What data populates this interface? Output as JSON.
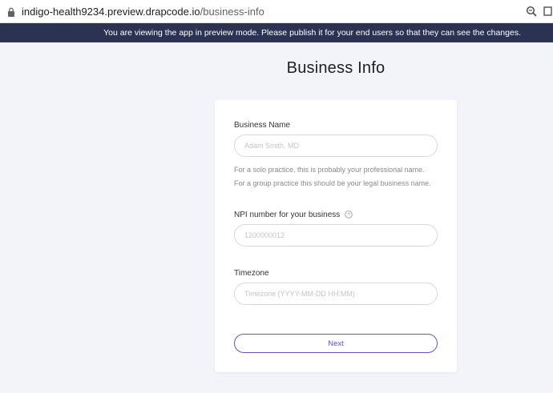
{
  "browser": {
    "url_host": "indigo-health9234.preview.drapcode.io",
    "url_path": "/business-info"
  },
  "banner": {
    "text": "You are viewing the app in preview mode. Please publish it for your end users so that they can see the changes."
  },
  "page": {
    "title": "Business Info"
  },
  "form": {
    "business_name": {
      "label": "Business Name",
      "placeholder": "Adam Smith, MD",
      "value": "",
      "hint_line1": "For a solo practice, this is probably your professional name.",
      "hint_line2": "For a group practice this should be your legal business name."
    },
    "npi": {
      "label": "NPI number for your business",
      "placeholder": "1200000012",
      "value": ""
    },
    "timezone": {
      "label": "Timezone",
      "placeholder": "Timezone (YYYY-MM-DD HH:MM)",
      "value": ""
    },
    "next_label": "Next"
  },
  "icons": {
    "lock": "lock-icon",
    "zoom": "zoom-icon",
    "share": "share-icon",
    "help": "help-icon"
  },
  "colors": {
    "banner_bg": "#2c3252",
    "accent": "#6b4fc8",
    "page_bg": "#f3f4fa"
  }
}
